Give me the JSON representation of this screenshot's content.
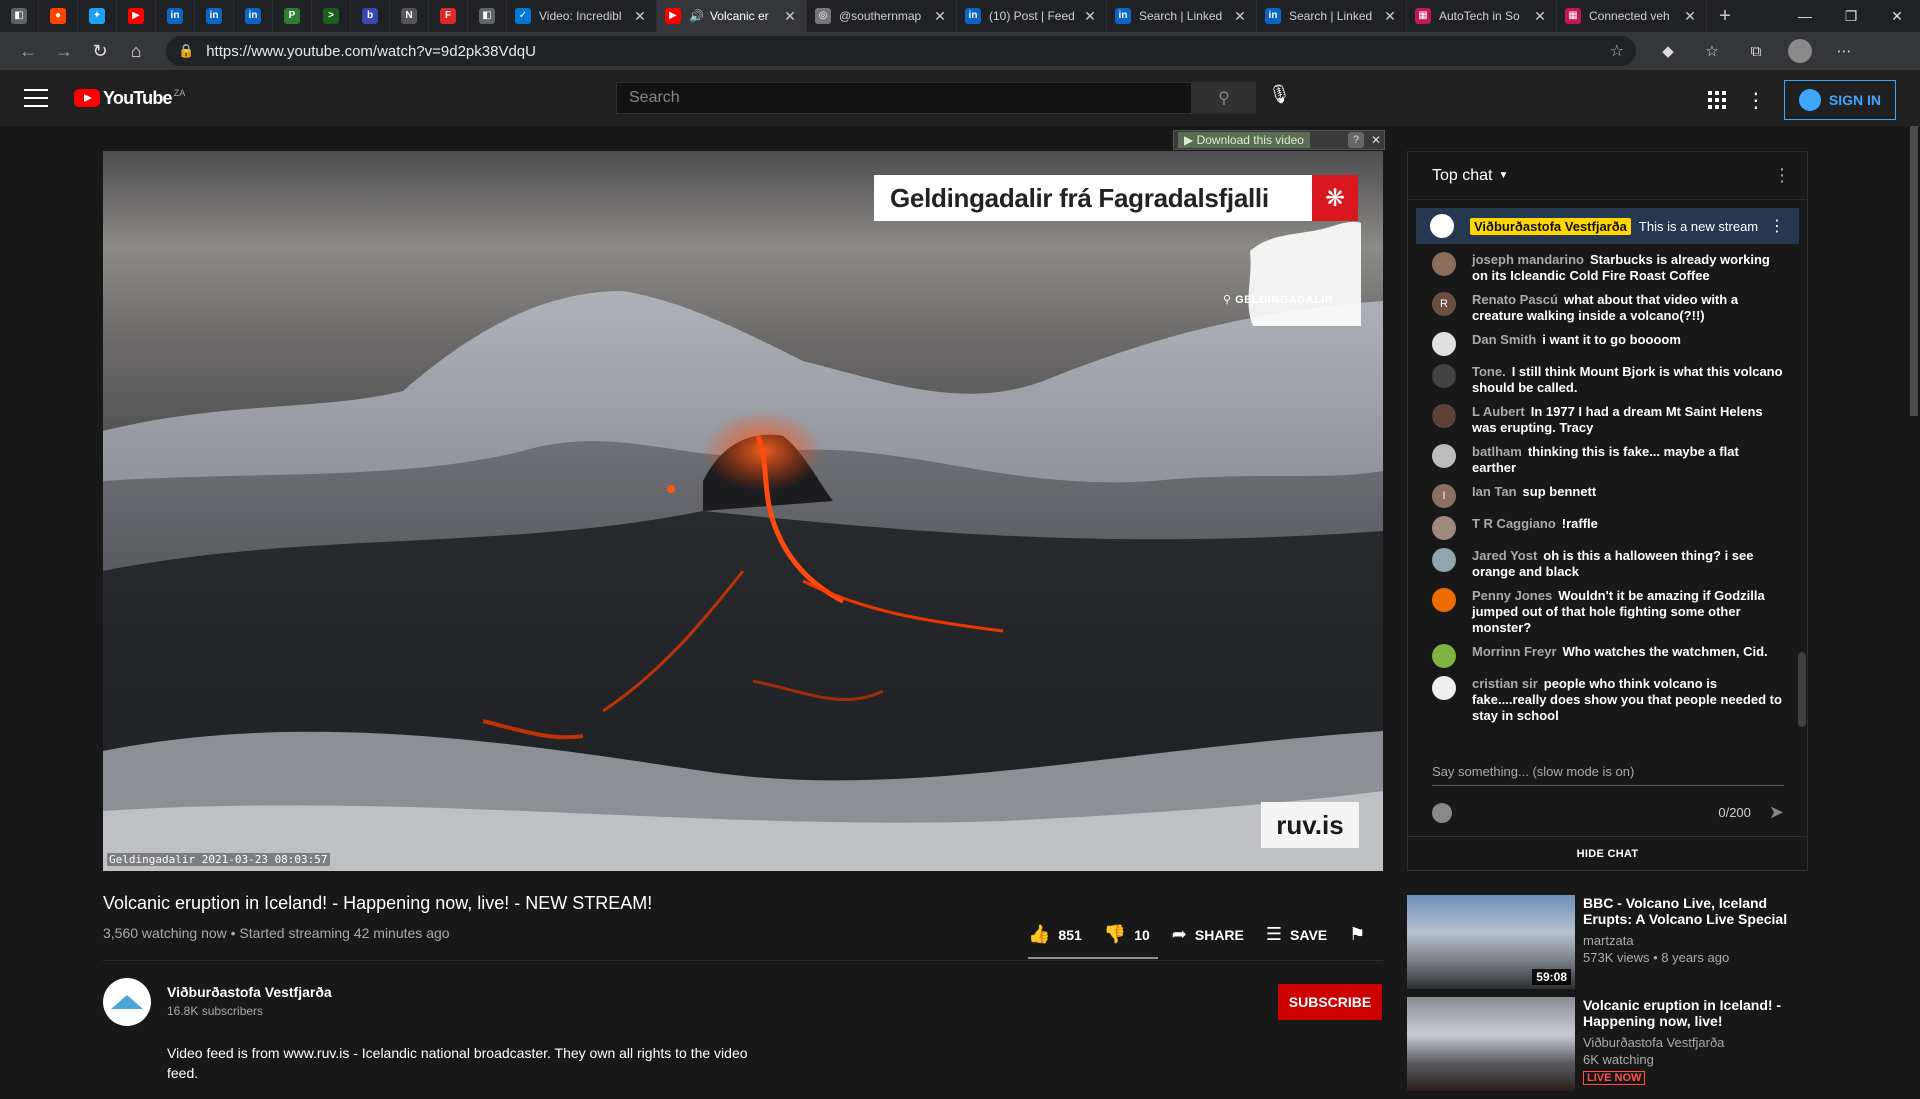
{
  "browser": {
    "pinned_tabs": [
      {
        "icon": "app-icon",
        "color": "#5f6368",
        "glyph": "◧"
      },
      {
        "icon": "reddit-icon",
        "color": "#ff4500",
        "glyph": "●"
      },
      {
        "icon": "twitter-icon",
        "color": "#1da1f2",
        "glyph": "✦"
      },
      {
        "icon": "youtube-icon",
        "color": "#ff0000",
        "glyph": "▶"
      },
      {
        "icon": "linkedin-icon",
        "color": "#0a66c2",
        "glyph": "in"
      },
      {
        "icon": "linkedin-icon",
        "color": "#0a66c2",
        "glyph": "in"
      },
      {
        "icon": "linkedin-icon",
        "color": "#0a66c2",
        "glyph": "in"
      },
      {
        "icon": "news-icon",
        "color": "#2e7d32",
        "glyph": "P"
      },
      {
        "icon": "terminal-icon",
        "color": "#1b5e20",
        "glyph": ">"
      },
      {
        "icon": "bu-icon",
        "color": "#3949ab",
        "glyph": "b"
      },
      {
        "icon": "notion-icon",
        "color": "#555555",
        "glyph": "N"
      },
      {
        "icon": "flipboard-icon",
        "color": "#e12828",
        "glyph": "F"
      },
      {
        "icon": "app-icon",
        "color": "#5f6368",
        "glyph": "◧"
      }
    ],
    "tabs": [
      {
        "label": "Video: Incredibl",
        "icon": "edge-icon",
        "color": "#0078d4",
        "glyph": "✓",
        "width": 150,
        "active": false
      },
      {
        "label": "Volcanic er",
        "icon": "youtube-icon",
        "color": "#ff0000",
        "glyph": "▶",
        "width": 150,
        "active": true,
        "audio": "🔊"
      },
      {
        "label": "@southernmap",
        "icon": "chrome-icon",
        "color": "#777777",
        "glyph": "◎",
        "width": 150,
        "active": false
      },
      {
        "label": "(10) Post | Feed",
        "icon": "linkedin-icon",
        "color": "#0a66c2",
        "glyph": "in",
        "width": 150,
        "active": false
      },
      {
        "label": "Search | Linked",
        "icon": "linkedin-icon",
        "color": "#0a66c2",
        "glyph": "in",
        "width": 150,
        "active": false
      },
      {
        "label": "Search | Linked",
        "icon": "linkedin-icon",
        "color": "#0a66c2",
        "glyph": "in",
        "width": 150,
        "active": false
      },
      {
        "label": "AutoTech in So",
        "icon": "grid-icon",
        "color": "#c2185b",
        "glyph": "▦",
        "width": 150,
        "active": false
      },
      {
        "label": "Connected veh",
        "icon": "grid-icon",
        "color": "#c2185b",
        "glyph": "▦",
        "width": 150,
        "active": false
      }
    ],
    "url": "https://www.youtube.com/watch?v=9d2pk38VdqU"
  },
  "header": {
    "logo_text": "YouTube",
    "country": "ZA",
    "search_placeholder": "Search",
    "signin_label": "SIGN IN"
  },
  "player": {
    "overlay_title": "Geldingadalir frá Fagradalsfjalli",
    "map_label": "⚲ GELDINGADALIR",
    "broadcaster_logo": "ruv.is",
    "timestamp": "Geldingadalir 2021-03-23 08:03:57",
    "download_label": "▶ Download this video",
    "download_help": "?",
    "download_close": "✕"
  },
  "video": {
    "title": "Volcanic eruption in Iceland! - Happening now, live! - NEW STREAM!",
    "meta": "3,560 watching now • Started streaming 42 minutes ago",
    "likes": "851",
    "dislikes": "10",
    "share_label": "SHARE",
    "save_label": "SAVE"
  },
  "channel": {
    "name": "Viðburðastofa Vestfjarða",
    "subscribers": "16.8K subscribers",
    "subscribe_label": "SUBSCRIBE",
    "description": "Video feed is from www.ruv.is - Icelandic national broadcaster. They own all rights to the video feed."
  },
  "chat": {
    "header": "Top chat",
    "pinned_author": "Viðburðastofa Vestfjarða",
    "pinned_text": "This is a new stream - we had some technical difficulties",
    "messages": [
      {
        "author": "joseph mandarino",
        "text": "Starbucks is already working on its Icleandic Cold Fire Roast Coffee",
        "color": "#8a6d5a",
        "initial": ""
      },
      {
        "author": "Renato Pascú",
        "text": "what about that video with a creature walking inside a volcano(?!!)",
        "color": "#6d4c41",
        "initial": "R"
      },
      {
        "author": "Dan Smith",
        "text": "i want it to go boooom",
        "color": "#e0e0e0",
        "initial": ""
      },
      {
        "author": "Tone.",
        "text": "I still think Mount Bjork is what this volcano should be called.",
        "color": "#424242",
        "initial": ""
      },
      {
        "author": "L Aubert",
        "text": "In 1977 I had a dream Mt Saint Helens was erupting. Tracy",
        "color": "#5d4037",
        "initial": ""
      },
      {
        "author": "batlham",
        "text": "thinking this is fake... maybe a flat earther",
        "color": "#bdbdbd",
        "initial": ""
      },
      {
        "author": "Ian Tan",
        "text": "sup bennett",
        "color": "#8d6e63",
        "initial": "I"
      },
      {
        "author": "T R Caggiano",
        "text": "!raffle",
        "color": "#a1887f",
        "initial": ""
      },
      {
        "author": "Jared Yost",
        "text": "oh is this a halloween thing? i see orange and black",
        "color": "#90a4ae",
        "initial": ""
      },
      {
        "author": "Penny Jones",
        "text": "Wouldn't it be amazing if Godzilla jumped out of that hole fighting some other monster?",
        "color": "#ef6c00",
        "initial": ""
      },
      {
        "author": "Morrinn Freyr",
        "text": "Who watches the watchmen, Cid.",
        "color": "#7cb342",
        "initial": ""
      },
      {
        "author": "cristian sir",
        "text": "people who think volcano is fake....really does show you that people needed to stay in school",
        "color": "#eeeeee",
        "initial": ""
      }
    ],
    "input_placeholder": "Say something... (slow mode is on)",
    "char_count": "0/200",
    "hide_label": "HIDE CHAT"
  },
  "related": [
    {
      "title": "BBC - Volcano Live, Iceland Erupts: A Volcano Live Special",
      "channel": "martzata",
      "views": "573K views • 8 years ago",
      "duration": "59:08",
      "live": ""
    },
    {
      "title": "Volcanic eruption in Iceland! - Happening now, live!",
      "channel": "Viðburðastofa Vestfjarða",
      "views": "6K watching",
      "duration": "",
      "live": "LIVE NOW"
    }
  ]
}
